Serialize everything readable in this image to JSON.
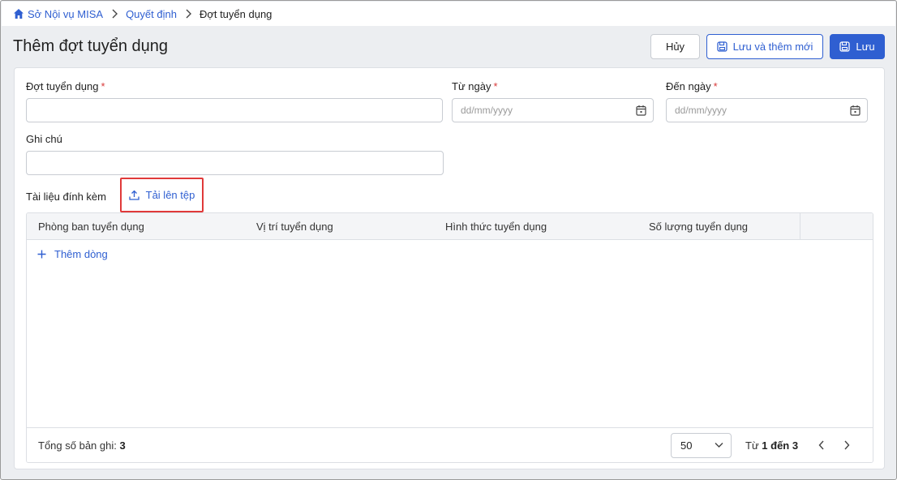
{
  "breadcrumb": {
    "items": [
      "Sở Nội vụ MISA",
      "Quyết định"
    ],
    "current": "Đợt tuyển dụng"
  },
  "page": {
    "title": "Thêm đợt tuyển dụng"
  },
  "toolbar": {
    "cancel_label": "Hủy",
    "save_new_label": "Lưu và thêm mới",
    "save_label": "Lưu"
  },
  "form": {
    "batch": {
      "label": "Đợt tuyển dụng",
      "required": "*",
      "value": ""
    },
    "from_date": {
      "label": "Từ ngày",
      "required": "*",
      "placeholder": "dd/mm/yyyy"
    },
    "to_date": {
      "label": "Đến ngày",
      "required": "*",
      "placeholder": "dd/mm/yyyy"
    },
    "note": {
      "label": "Ghi chú",
      "value": ""
    },
    "attachments": {
      "label": "Tài liệu đính kèm",
      "upload_label": "Tải lên tệp"
    }
  },
  "grid": {
    "columns": [
      "Phòng ban tuyển dụng",
      "Vị trí tuyển dụng",
      "Hình thức tuyển dụng",
      "Số lượng tuyển dụng"
    ],
    "add_row_label": "Thêm dòng",
    "footer": {
      "total_label": "Tổng số bản ghi:",
      "total_value": "3",
      "page_size": "50",
      "range_prefix": "Từ",
      "range_from": "1",
      "range_mid": "đến",
      "range_to": "3"
    }
  },
  "colors": {
    "accent": "#2f5fd1",
    "required": "#d83a3a",
    "highlight_border": "#e03a3a",
    "background": "#eceef1"
  },
  "icons": [
    "home-icon",
    "chevron-right-icon",
    "save-icon",
    "calendar-icon",
    "upload-icon",
    "plus-icon",
    "chevron-down-icon",
    "chevron-left-icon"
  ]
}
